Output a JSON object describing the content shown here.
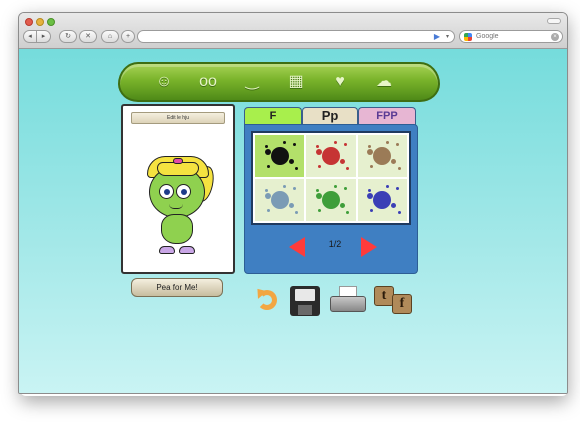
{
  "browser": {
    "traffic_lights": [
      "close",
      "minimize",
      "zoom"
    ],
    "back_glyph": "◂",
    "forward_glyph": "▸",
    "address_go": "▶",
    "address_dropdown": "▾",
    "search_placeholder": "Google",
    "search_clear": "×"
  },
  "nav": {
    "items": [
      {
        "name": "face-icon",
        "glyph": "☺"
      },
      {
        "name": "eyes-icon",
        "glyph": "oo"
      },
      {
        "name": "mouth-icon",
        "glyph": "‿"
      },
      {
        "name": "outfit-icon",
        "glyph": "▦"
      },
      {
        "name": "accessories-icon",
        "glyph": "♥"
      },
      {
        "name": "shoes-icon",
        "glyph": "☁"
      }
    ]
  },
  "preview": {
    "title": "Edit le hju",
    "pea_button": "Pea for Me!"
  },
  "paint": {
    "tabs": [
      "F",
      "Pp",
      "FPP"
    ],
    "swatches": [
      {
        "color": "#111111",
        "selected": true
      },
      {
        "color": "#c63434",
        "selected": false
      },
      {
        "color": "#9b7b57",
        "selected": false
      },
      {
        "color": "#7a9bb5",
        "selected": false
      },
      {
        "color": "#3f9e3a",
        "selected": false
      },
      {
        "color": "#3b3fb6",
        "selected": false
      }
    ],
    "page": "1/2"
  },
  "tools": {
    "twitter": "t",
    "facebook": "f"
  }
}
